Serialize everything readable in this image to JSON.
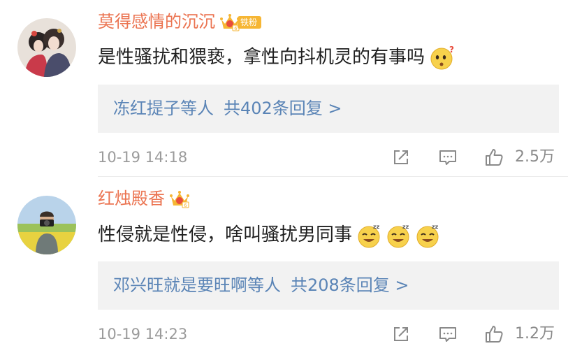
{
  "comments": [
    {
      "username": "莫得感情的沉沉",
      "fan_badge": "铁粉",
      "text": "是性骚扰和猥亵，拿性向抖机灵的有事吗",
      "emoji": [
        "thinking-emoji"
      ],
      "reply_names": "冻红提子等人",
      "reply_count": "共402条回复 >",
      "timestamp": "10-19 14:18",
      "likes": "2.5万"
    },
    {
      "username": "红烛殿香",
      "text": "性侵就是性侵，啥叫骚扰男同事",
      "emoji": [
        "sleepy-smile-emoji",
        "sleepy-smile-emoji",
        "sleepy-smile-emoji"
      ],
      "reply_names": "邓兴旺就是要旺啊等人",
      "reply_count": "共208条回复 >",
      "timestamp": "10-19 14:23",
      "likes": "1.2万"
    }
  ],
  "colors": {
    "username": "#eb7350",
    "link": "#5a84b6",
    "meta": "#9b9b9b",
    "reply_bg": "#f2f2f2",
    "badge": "#f6b634"
  }
}
